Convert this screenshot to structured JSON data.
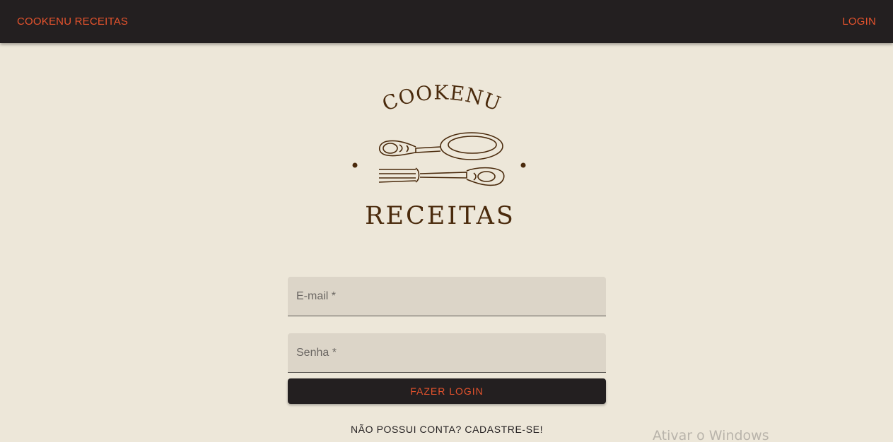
{
  "appbar": {
    "brand_label": "COOKENU RECEITAS",
    "login_label": "LOGIN",
    "background_color": "#231f20",
    "accent_color": "#e5532d"
  },
  "logo": {
    "top_text": "COOKENU",
    "bottom_text": "RECEITAS",
    "icon": "spoon-fork-icon",
    "color": "#4a2a0c"
  },
  "form": {
    "email_label": "E-mail *",
    "email_value": "",
    "password_label": "Senha *",
    "password_value": "",
    "submit_label": "FAZER LOGIN"
  },
  "signup_link": "NÃO POSSUI CONTA? CADASTRE-SE!",
  "os_watermark": "Ativar o Windows",
  "page_background": "#ede7d9"
}
